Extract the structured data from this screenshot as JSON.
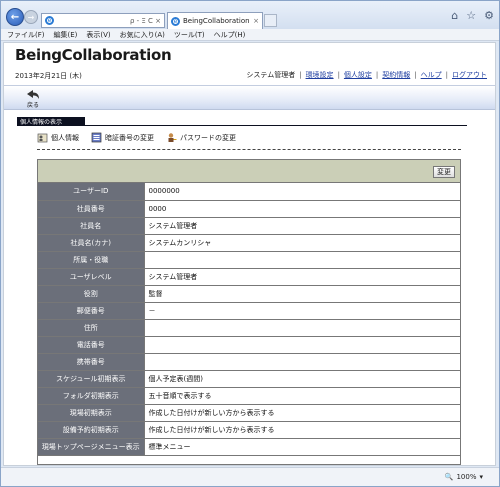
{
  "browser": {
    "tab_title": "BeingCollaboration",
    "address_tools": "ρ - Ξ C ×",
    "menu": [
      "ファイル(F)",
      "編集(E)",
      "表示(V)",
      "お気に入り(A)",
      "ツール(T)",
      "ヘルプ(H)"
    ],
    "zoom": "100%"
  },
  "app": {
    "title": "BeingCollaboration",
    "date": "2013年2月21日 (木)",
    "user_role": "システム管理者",
    "links": [
      "環境設定",
      "個人設定",
      "契約情報",
      "ヘルプ",
      "ログアウト"
    ],
    "back_label": "戻る"
  },
  "section": {
    "title": "個人情報の表示",
    "subtabs": [
      "個人情報",
      "暗証番号の変更",
      "パスワードの変更"
    ],
    "edit_button": "変更"
  },
  "profile": {
    "rows": [
      {
        "label": "ユーザーID",
        "value": "0000000"
      },
      {
        "label": "社員番号",
        "value": "0000"
      },
      {
        "label": "社員名",
        "value": "システム管理者"
      },
      {
        "label": "社員名(カナ)",
        "value": "システムカンリシャ"
      },
      {
        "label": "所属・役職",
        "value": ""
      },
      {
        "label": "ユーザレベル",
        "value": "システム管理者"
      },
      {
        "label": "役割",
        "value": "監督"
      },
      {
        "label": "郵便番号",
        "value": "－"
      },
      {
        "label": "住所",
        "value": ""
      },
      {
        "label": "電話番号",
        "value": ""
      },
      {
        "label": "携帯番号",
        "value": ""
      },
      {
        "label": "スケジュール初期表示",
        "value": "個人予定表(週間)"
      },
      {
        "label": "フォルダ初期表示",
        "value": "五十音順で表示する"
      },
      {
        "label": "現場初期表示",
        "value": "作成した日付けが新しい方から表示する"
      },
      {
        "label": "設備予約初期表示",
        "value": "作成した日付けが新しい方から表示する"
      },
      {
        "label": "現場トップページメニュー表示",
        "value": "標準メニュー"
      }
    ]
  }
}
